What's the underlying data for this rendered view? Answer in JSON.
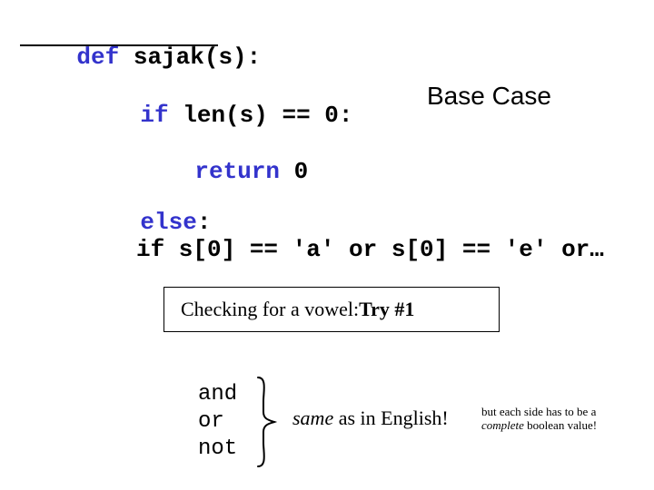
{
  "def_line": {
    "kw": "def",
    "rest": " sajak(s):"
  },
  "if_line": {
    "kw": "if",
    "rest": " len(s) == 0:"
  },
  "return_line": {
    "kw": "return",
    "rest": " 0"
  },
  "else_line": {
    "kw": "else",
    "rest": ":"
  },
  "inner_if": "if s[0] == 'a' or s[0] == 'e' or…",
  "base_case": "Base Case",
  "checking": {
    "prefix": "Checking for a vowel:  ",
    "bold": "Try #1"
  },
  "ops": "and\nor\nnot",
  "same": {
    "italic": "same",
    "rest": " as in English!"
  },
  "sidenote": {
    "line1_plain": "but each side has to be a ",
    "line2_italic": "complete",
    "line2_rest": " boolean value!"
  }
}
